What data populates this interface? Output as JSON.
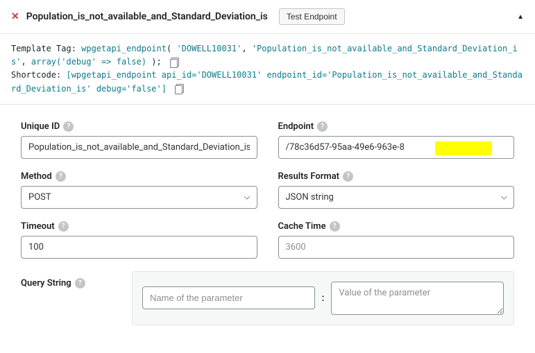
{
  "header": {
    "title": "Population_is_not_available_and_Standard_Deviation_is",
    "test_btn": "Test Endpoint",
    "collapse_glyph": "▲"
  },
  "code": {
    "template_label": "Template Tag: ",
    "fn_name": "wpgetapi_endpoint",
    "fn_open": "( ",
    "arg1": "'DOWELL10031'",
    "sep1": ", ",
    "arg2": "'Population_is_not_available_and_Standard_Deviation_is'",
    "sep2": ", ",
    "arg3": "array('debug' => false)",
    "fn_close": " );",
    "shortcode_label": "Shortcode: ",
    "sc_open": "[wpgetapi_endpoint ",
    "sc_attr1": "api_id='DOWELL10031'",
    "sc_sp1": " ",
    "sc_attr2": "endpoint_id='Population_is_not_available_and_Standard_Deviation_is'",
    "sc_sp2": " ",
    "sc_attr3": "debug='false'",
    "sc_close": "]"
  },
  "fields": {
    "unique_id": {
      "label": "Unique ID",
      "value": "Population_is_not_available_and_Standard_Deviation_is"
    },
    "endpoint": {
      "label": "Endpoint",
      "value": "/78c36d57-95aa-49e6-963e-8                         )/"
    },
    "method": {
      "label": "Method",
      "value": "POST"
    },
    "results_format": {
      "label": "Results Format",
      "value": "JSON string"
    },
    "timeout": {
      "label": "Timeout",
      "value": "100"
    },
    "cache_time": {
      "label": "Cache Time",
      "placeholder": "3600"
    },
    "query_string": {
      "label": "Query String",
      "name_ph": "Name of the parameter",
      "value_ph": "Value of the parameter"
    }
  },
  "help_glyph": "?"
}
